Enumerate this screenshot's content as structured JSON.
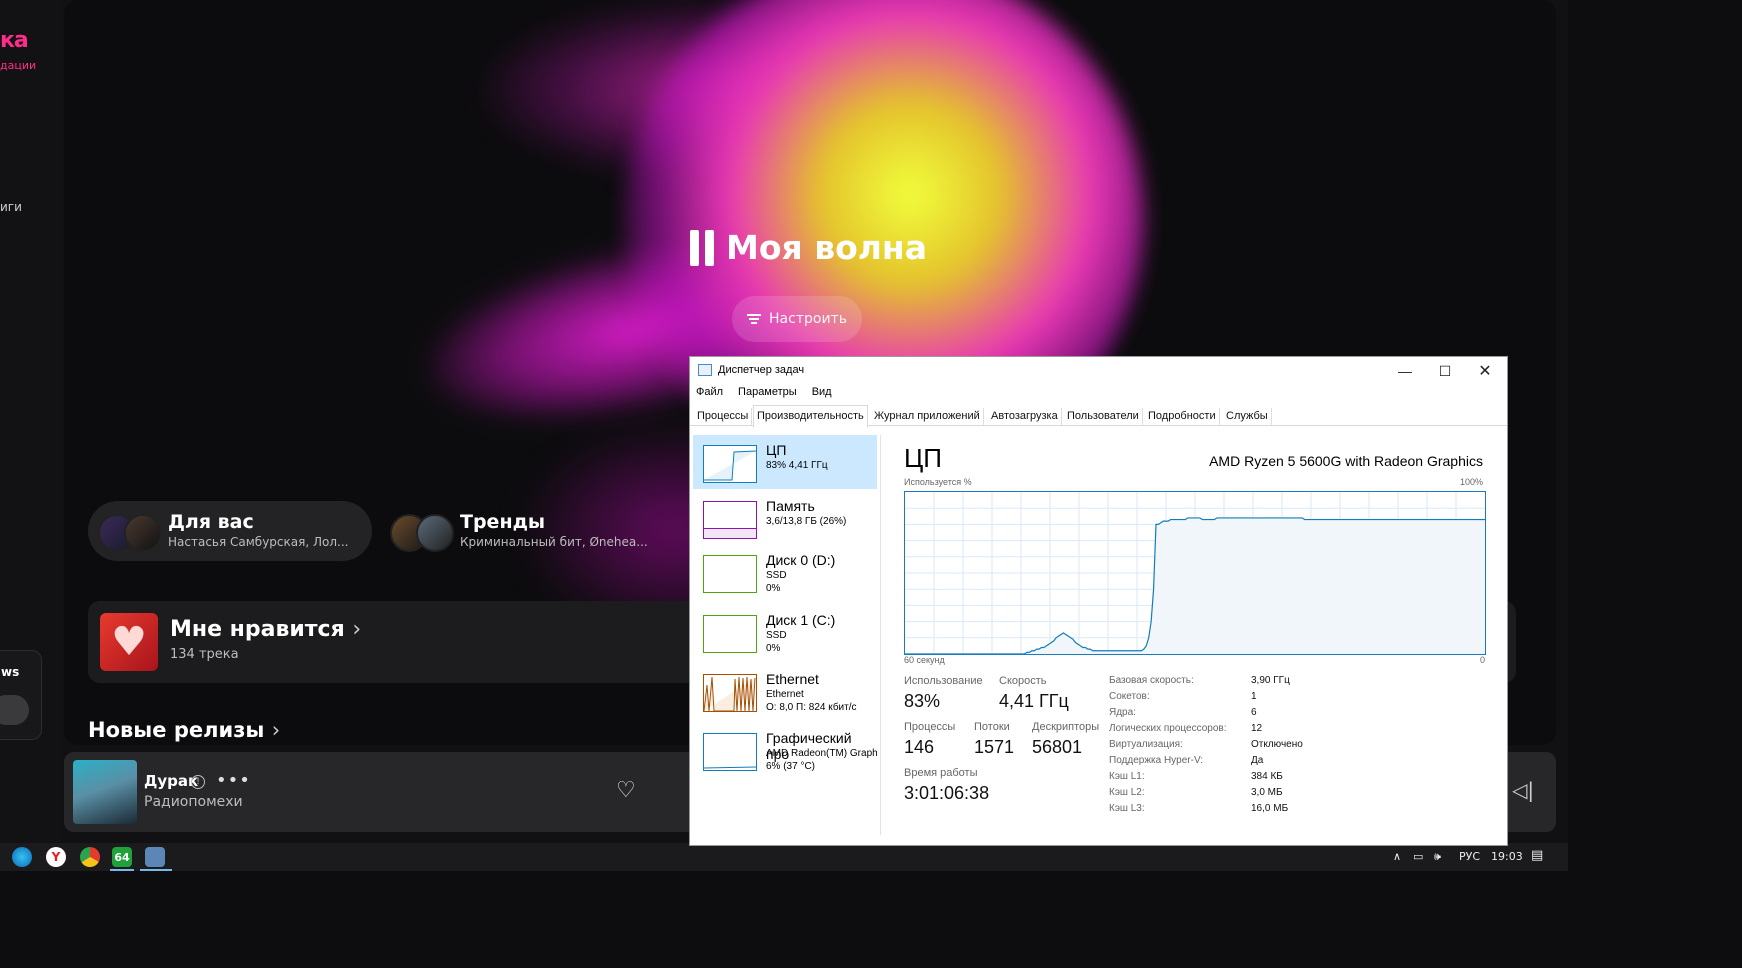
{
  "music": {
    "logo": "ка",
    "logo_sub": "дации",
    "sidebar_fragment": "иги",
    "side_card_title": "ws",
    "wave_title": "Моя волна",
    "tune_label": "Настроить",
    "chips": [
      {
        "title": "Для вас",
        "subtitle": "Настасья Самбурская, Лол..."
      },
      {
        "title": "Тренды",
        "subtitle": "Криминальный бит, Øneheа..."
      }
    ],
    "likes_title": "Мне нравится",
    "likes_sub": "134 трека",
    "new_releases": "Новые релизы",
    "player": {
      "track": "Дурак",
      "artist": "Радиопомехи"
    }
  },
  "taskbar": {
    "icons": [
      "edge-icon",
      "yandex-browser-icon",
      "chrome-icon",
      "aida64-icon",
      "task-manager-icon"
    ],
    "aida_label": "64",
    "lang": "РУС",
    "time": "19:03"
  },
  "task_manager": {
    "title": "Диспетчер задач",
    "menu": [
      "Файл",
      "Параметры",
      "Вид"
    ],
    "tabs": [
      "Процессы",
      "Производительность",
      "Журнал приложений",
      "Автозагрузка",
      "Пользователи",
      "Подробности",
      "Службы"
    ],
    "active_tab": "Производительность",
    "resources": [
      {
        "name": "ЦП",
        "line1": "83% 4,41 ГГц",
        "line2": "",
        "color": "#117dbb"
      },
      {
        "name": "Память",
        "line1": "3,6/13,8 ГБ (26%)",
        "line2": "",
        "color": "#8b12ae"
      },
      {
        "name": "Диск 0 (D:)",
        "line1": "SSD",
        "line2": "0%",
        "color": "#4da60c"
      },
      {
        "name": "Диск 1 (C:)",
        "line1": "SSD",
        "line2": "0%",
        "color": "#4da60c"
      },
      {
        "name": "Ethernet",
        "line1": "Ethernet",
        "line2": "О: 8,0 П: 824 кбит/с",
        "color": "#a74f01"
      },
      {
        "name": "Графический про",
        "line1": "AMD Radeon(TM) Graph",
        "line2": "6% (37 °C)",
        "color": "#117dbb"
      }
    ],
    "cpu": {
      "heading": "ЦП",
      "model": "AMD Ryzen 5 5600G with Radeon Graphics",
      "graph_top_left": "Используется %",
      "graph_top_right": "100%",
      "graph_bottom_left": "60 секунд",
      "graph_bottom_right": "0",
      "usage_label": "Использование",
      "usage": "83%",
      "speed_label": "Скорость",
      "speed": "4,41 ГГц",
      "processes_label": "Процессы",
      "processes": "146",
      "threads_label": "Потоки",
      "threads": "1571",
      "handles_label": "Дескрипторы",
      "handles": "56801",
      "uptime_label": "Время работы",
      "uptime": "3:01:06:38",
      "specs": [
        {
          "k": "Базовая скорость:",
          "v": "3,90 ГГц"
        },
        {
          "k": "Сокетов:",
          "v": "1"
        },
        {
          "k": "Ядра:",
          "v": "6"
        },
        {
          "k": "Логических процессоров:",
          "v": "12"
        },
        {
          "k": "Виртуализация:",
          "v": "Отключено"
        },
        {
          "k": "Поддержка Hyper-V:",
          "v": "Да"
        },
        {
          "k": "Кэш L1:",
          "v": "384 КБ"
        },
        {
          "k": "Кэш L2:",
          "v": "3,0 МБ"
        },
        {
          "k": "Кэш L3:",
          "v": "16,0 МБ"
        }
      ],
      "usage_history": [
        0,
        0,
        0,
        0,
        0,
        0,
        0,
        0,
        0,
        0,
        0,
        0,
        0,
        0,
        0,
        0,
        0,
        0,
        0,
        0,
        0,
        0,
        0,
        0,
        0,
        0,
        0,
        0,
        0,
        0,
        0,
        0,
        0,
        0,
        0,
        0,
        0,
        0,
        0,
        0,
        0,
        0,
        0,
        0,
        0,
        0,
        0,
        0,
        0,
        0,
        1,
        1,
        2,
        2,
        3,
        3,
        4,
        4,
        5,
        6,
        7,
        8,
        10,
        11,
        12,
        13,
        12,
        11,
        10,
        9,
        7,
        6,
        5,
        4,
        4,
        3,
        3,
        2,
        2,
        2,
        2,
        2,
        2,
        2,
        2,
        2,
        2,
        2,
        2,
        2,
        2,
        2,
        2,
        2,
        2,
        2,
        2,
        2,
        3,
        5,
        10,
        20,
        40,
        80,
        80,
        81,
        82,
        82,
        82,
        83,
        83,
        83,
        83,
        83,
        83,
        83,
        84,
        84,
        84,
        84,
        84,
        84,
        83,
        83,
        83,
        83,
        83,
        83,
        84,
        84,
        84,
        84,
        84,
        84,
        84,
        84,
        84,
        84,
        84,
        84,
        84,
        84,
        84,
        84,
        84,
        84,
        84,
        84,
        84,
        84,
        84,
        84,
        84,
        84,
        84,
        84,
        84,
        84,
        84,
        84,
        84,
        84,
        84,
        84,
        83,
        83,
        83,
        83,
        83,
        83,
        83,
        83,
        83,
        83,
        83,
        83,
        83,
        83,
        83,
        83,
        83,
        83,
        83,
        83,
        83,
        83,
        83,
        83,
        83,
        83,
        83,
        83,
        83,
        83,
        83,
        83,
        83,
        83,
        83,
        83,
        83,
        83,
        83,
        83,
        83,
        83,
        83,
        83,
        83,
        83,
        83,
        83,
        83,
        83,
        83,
        83,
        83,
        83,
        83,
        83,
        83,
        83,
        83,
        83,
        83,
        83,
        83,
        83,
        83,
        83,
        83,
        83,
        83,
        83,
        83,
        83,
        83,
        83,
        83
      ]
    }
  }
}
